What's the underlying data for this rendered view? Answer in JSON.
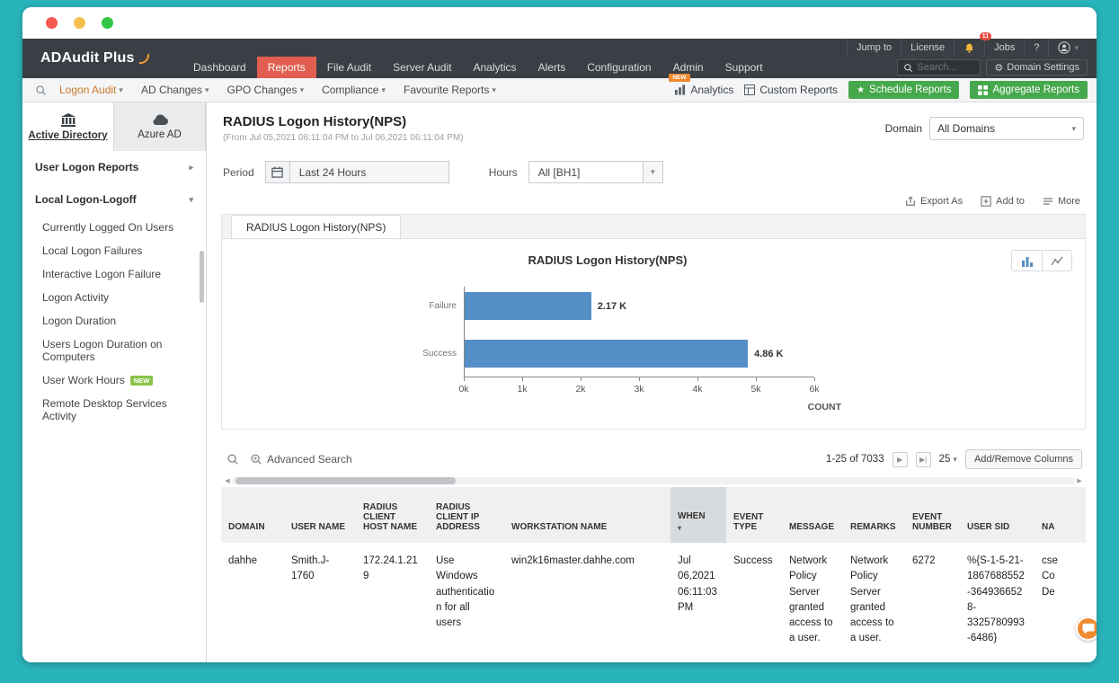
{
  "topbar": {
    "brand": "ADAudit Plus",
    "utility": {
      "jump_to": "Jump to",
      "license": "License",
      "bell_badge": "11",
      "jobs": "Jobs",
      "help": "?"
    },
    "nav": [
      "Dashboard",
      "Reports",
      "File Audit",
      "Server Audit",
      "Analytics",
      "Alerts",
      "Configuration",
      "Admin",
      "Support"
    ],
    "active_nav": "Reports",
    "search_placeholder": "Search...",
    "domain_settings": "Domain Settings"
  },
  "ribbon": {
    "menus": [
      "Logon Audit",
      "AD Changes",
      "GPO Changes",
      "Compliance",
      "Favourite Reports"
    ],
    "analytics": {
      "label": "Analytics",
      "badge": "NEW"
    },
    "custom_reports": "Custom Reports",
    "schedule_reports": "Schedule Reports",
    "aggregate_reports": "Aggregate Reports"
  },
  "sidebar": {
    "tabs": [
      {
        "label": "Active Directory"
      },
      {
        "label": "Azure AD"
      }
    ],
    "sections": [
      {
        "label": "User Logon Reports"
      },
      {
        "label": "Local Logon-Logoff"
      }
    ],
    "items": [
      {
        "label": "Currently Logged On Users"
      },
      {
        "label": "Local Logon Failures"
      },
      {
        "label": "Interactive Logon Failure"
      },
      {
        "label": "Logon Activity"
      },
      {
        "label": "Logon Duration"
      },
      {
        "label": "Users Logon Duration on Computers"
      },
      {
        "label": "User Work Hours",
        "badge": "NEW"
      },
      {
        "label": "Remote Desktop Services Activity"
      }
    ]
  },
  "report": {
    "title": "RADIUS Logon History(NPS)",
    "subtitle": "(From Jul 05,2021 06:11:04 PM to Jul 06,2021 06:11:04 PM)",
    "domain_label": "Domain",
    "domain_value": "All Domains",
    "period_label": "Period",
    "period_value": "Last 24 Hours",
    "hours_label": "Hours",
    "hours_value": "All [BH1]",
    "export_as": "Export As",
    "add_to": "Add to",
    "more": "More",
    "tab": "RADIUS Logon History(NPS)"
  },
  "chart_data": {
    "type": "bar",
    "orientation": "horizontal",
    "title": "RADIUS Logon History(NPS)",
    "categories": [
      "Failure",
      "Success"
    ],
    "values": [
      2170,
      4860
    ],
    "value_labels": [
      "2.17 K",
      "4.86 K"
    ],
    "xlabel": "COUNT",
    "x_ticks": [
      "0k",
      "1k",
      "2k",
      "3k",
      "4k",
      "5k",
      "6k"
    ],
    "xlim": [
      0,
      6000
    ],
    "bar_color": "#538fc6",
    "grid": false,
    "legend": false
  },
  "table": {
    "advanced_search": "Advanced Search",
    "pagination": "1-25 of 7033",
    "page_size": "25",
    "add_remove_columns": "Add/Remove Columns",
    "sorted_column": "WHEN",
    "columns": [
      "DOMAIN",
      "USER NAME",
      "RADIUS CLIENT HOST NAME",
      "RADIUS CLIENT IP ADDRESS",
      "WORKSTATION NAME",
      "WHEN",
      "EVENT TYPE",
      "MESSAGE",
      "REMARKS",
      "EVENT NUMBER",
      "USER SID",
      "NA"
    ],
    "rows": [
      [
        "dahhe",
        "Smith.J-1760",
        "172.24.1.219",
        "Use Windows authentication for all users",
        "win2k16master.dahhe.com",
        "Jul 06,2021 06:11:03 PM",
        "Success",
        "Network Policy Server granted access to a user.",
        "Network Policy Server granted access to a user.",
        "6272",
        "%{S-1-5-21-1867688552-3649366528-3325780993-6486}",
        "cse\nCo\nDe"
      ]
    ]
  },
  "colors": {
    "frame": "#29b3ba",
    "header_bg": "#3a3f45",
    "active_nav": "#e15d50",
    "green_button": "#46a84c",
    "bar": "#538fc6",
    "new_badge": "#8bc34a"
  }
}
